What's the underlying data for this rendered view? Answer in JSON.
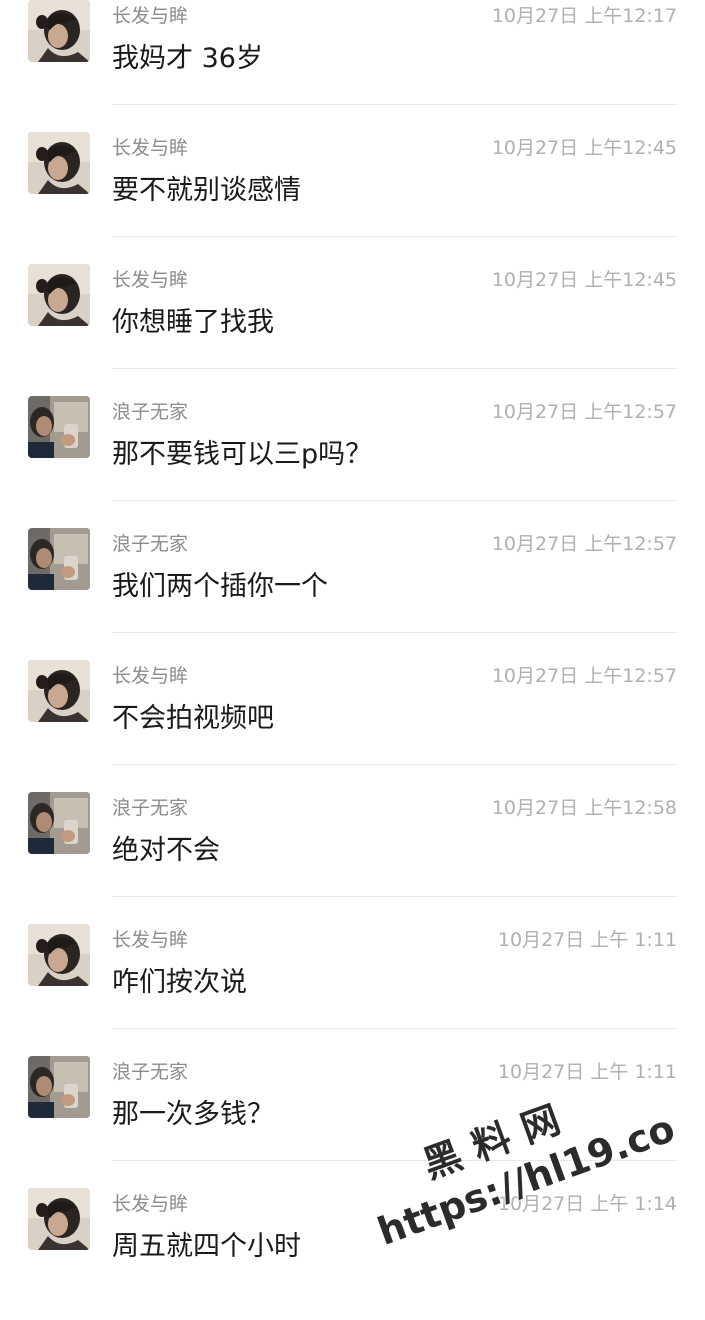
{
  "messages": [
    {
      "sender": "长发与眸",
      "time": "10月27日 上午12:17",
      "text": "我妈才 36岁",
      "avatar": "avatar-girl"
    },
    {
      "sender": "长发与眸",
      "time": "10月27日 上午12:45",
      "text": "要不就别谈感情",
      "avatar": "avatar-girl"
    },
    {
      "sender": "长发与眸",
      "time": "10月27日 上午12:45",
      "text": "你想睡了找我",
      "avatar": "avatar-girl"
    },
    {
      "sender": "浪子无家",
      "time": "10月27日 上午12:57",
      "text": "那不要钱可以三p吗？",
      "avatar": "avatar-man"
    },
    {
      "sender": "浪子无家",
      "time": "10月27日 上午12:57",
      "text": "我们两个插你一个",
      "avatar": "avatar-man"
    },
    {
      "sender": "长发与眸",
      "time": "10月27日 上午12:57",
      "text": "不会拍视频吧",
      "avatar": "avatar-girl"
    },
    {
      "sender": "浪子无家",
      "time": "10月27日 上午12:58",
      "text": "绝对不会",
      "avatar": "avatar-man"
    },
    {
      "sender": "长发与眸",
      "time": "10月27日 上午 1:11",
      "text": "咋们按次说",
      "avatar": "avatar-girl"
    },
    {
      "sender": "浪子无家",
      "time": "10月27日 上午 1:11",
      "text": "那一次多钱？",
      "avatar": "avatar-man"
    },
    {
      "sender": "长发与眸",
      "time": "10月27日 上午 1:14",
      "text": "周五就四个小时",
      "avatar": "avatar-girl"
    }
  ],
  "watermark": {
    "line1": "黑料网",
    "line2": "https://hl19.co"
  },
  "colors": {
    "sender": "#8c8c8c",
    "time": "#b0b0b0",
    "message": "#1a1a1a",
    "divider": "#e6e6e6"
  }
}
